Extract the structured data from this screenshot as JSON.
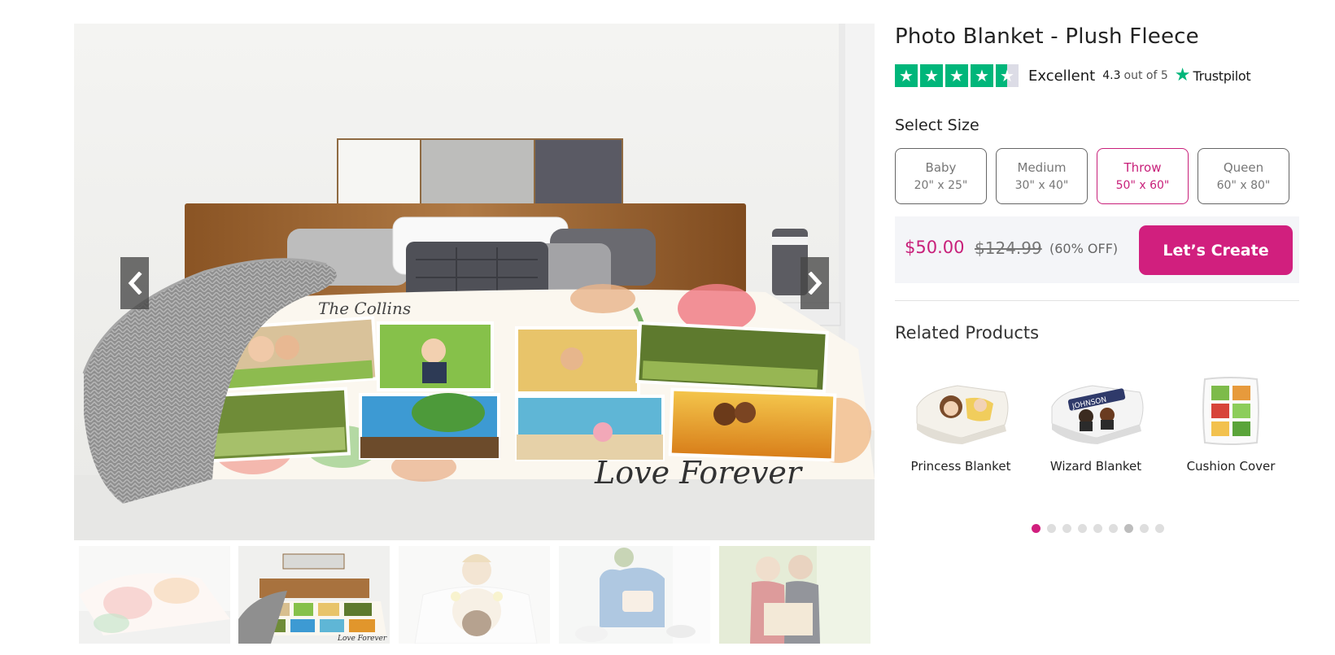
{
  "product": {
    "title": "Photo Blanket - Plush Fleece"
  },
  "rating": {
    "word": "Excellent",
    "score": "4.3",
    "out_of": "out of 5",
    "stars": 4.5,
    "brand": "Trustpilot",
    "brand_color": "#00b67a"
  },
  "size": {
    "label": "Select Size",
    "options": [
      {
        "name": "Baby",
        "dims": "20\" x 25\""
      },
      {
        "name": "Medium",
        "dims": "30\" x 40\""
      },
      {
        "name": "Throw",
        "dims": "50\" x 60\""
      },
      {
        "name": "Queen",
        "dims": "60\" x 80\""
      }
    ],
    "selected": "Throw"
  },
  "price": {
    "current": "$50.00",
    "original": "$124.99",
    "discount": "(60% OFF)",
    "cta": "Let’s Create",
    "accent_color": "#d11f7e"
  },
  "gallery": {
    "main_caption_top": "The Collins",
    "main_caption_bottom": "Love Forever",
    "thumb_caption": "Love Forever",
    "active_thumb": 1,
    "thumb_count": 5
  },
  "related": {
    "title": "Related Products",
    "items": [
      {
        "name": "Princess Blanket",
        "icon": "princess-blanket-image"
      },
      {
        "name": "Wizard Blanket",
        "icon": "wizard-blanket-image"
      },
      {
        "name": "Cushion Cover",
        "icon": "cushion-cover-image"
      }
    ],
    "pagination_count": 9,
    "pagination_active": 0
  }
}
